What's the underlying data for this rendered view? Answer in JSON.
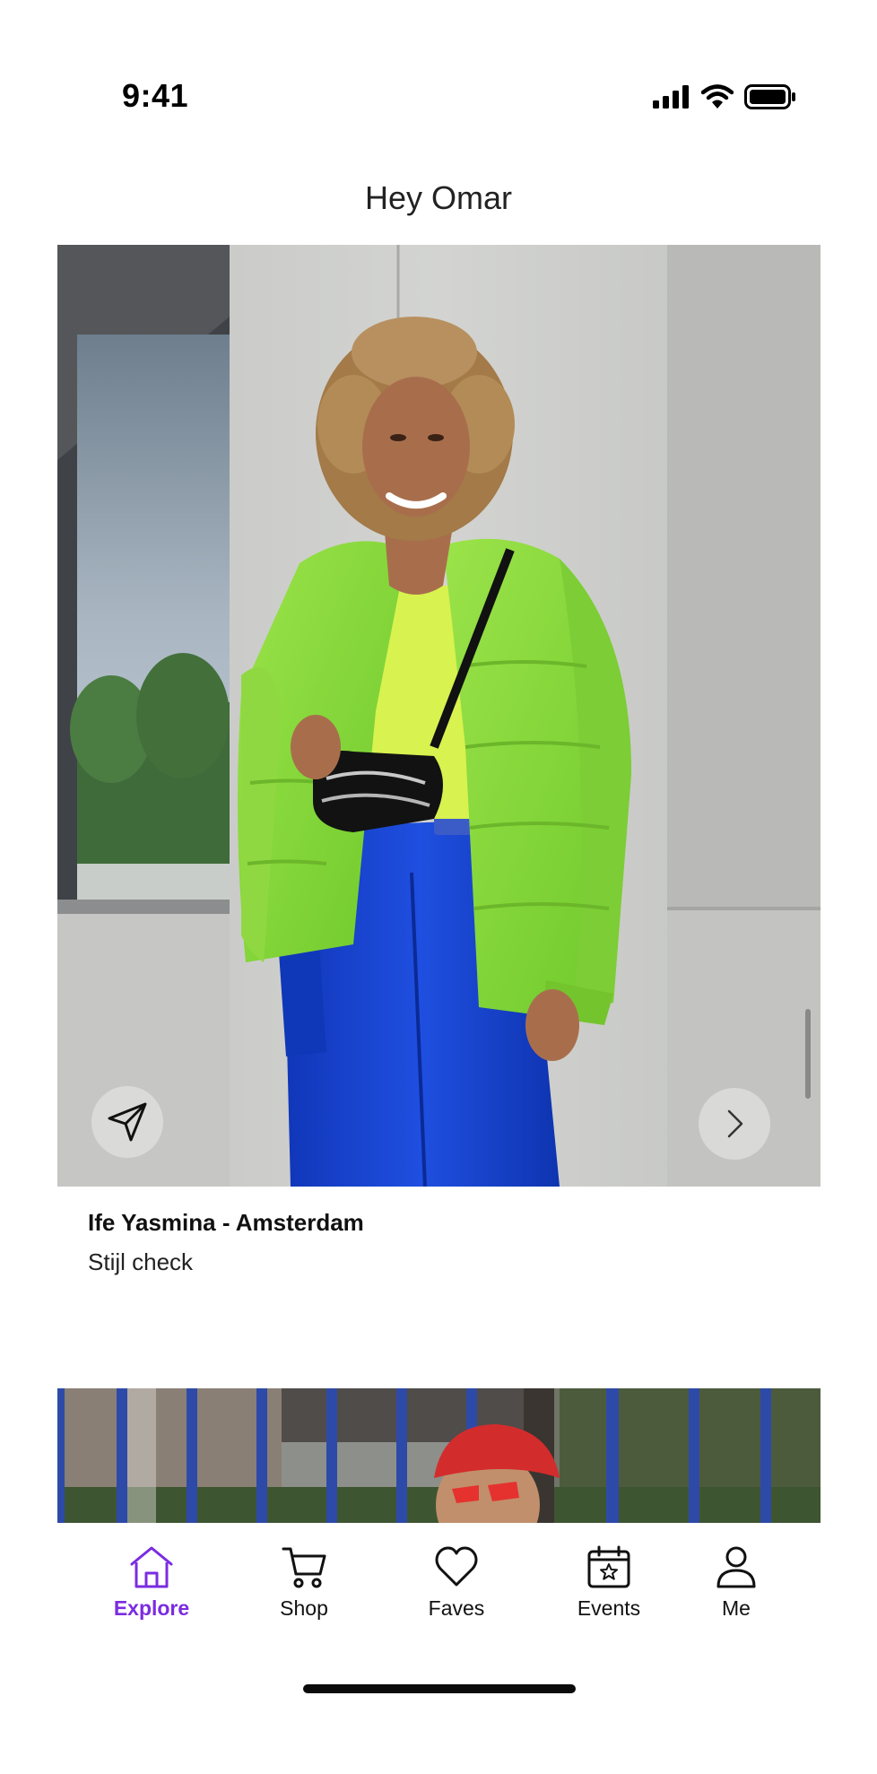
{
  "status_bar": {
    "time": "9:41"
  },
  "header": {
    "title": "Hey Omar"
  },
  "feed": {
    "cards": [
      {
        "title": "Ife Yasmina - Amsterdam",
        "subtitle": "Stijl check"
      }
    ]
  },
  "tabs": [
    {
      "label": "Explore",
      "icon": "home-icon",
      "active": true
    },
    {
      "label": "Shop",
      "icon": "cart-icon",
      "active": false
    },
    {
      "label": "Faves",
      "icon": "heart-icon",
      "active": false
    },
    {
      "label": "Events",
      "icon": "calendar-star-icon",
      "active": false
    },
    {
      "label": "Me",
      "icon": "person-icon",
      "active": false
    }
  ],
  "colors": {
    "accent": "#7b2ce0",
    "text": "#111111",
    "background": "#ffffff"
  }
}
